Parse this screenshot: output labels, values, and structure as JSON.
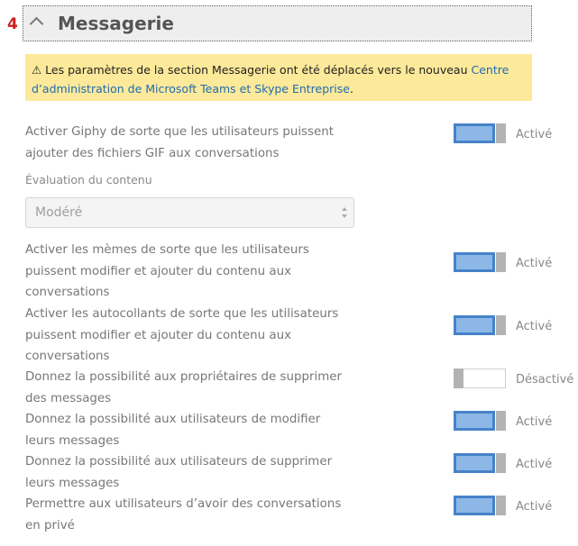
{
  "step_number": "4",
  "section": {
    "title": "Messagerie"
  },
  "notice": {
    "icon": "warning-icon",
    "text": "⚠ Les paramètres de la section Messagerie ont été déplacés vers le nouveau ",
    "link": "Centre d’administration de Microsoft Teams et Skype Entreprise",
    "suffix": "."
  },
  "colors": {
    "accent": "#4682c9",
    "toggle_fill": "#8cb7e6",
    "notice_bg": "#fce99a",
    "step": "#c8201f"
  },
  "settings": [
    {
      "line1": "Activer Giphy de sorte que les utilisateurs puissent",
      "line2": "ajouter des fichiers GIF aux conversations",
      "state": "Activé",
      "on": true
    },
    {
      "line1": "Activer les mèmes de sorte que les utilisateurs",
      "line2": "puissent modifier et ajouter du contenu aux",
      "line3": "conversations",
      "state": "Activé",
      "on": true
    },
    {
      "line1": "Activer les autocollants de sorte que les utilisateurs",
      "line2": "puissent modifier et ajouter du contenu aux",
      "line3": "conversations",
      "state": "Activé",
      "on": true
    },
    {
      "line1": "Donnez la possibilité aux propriétaires de supprimer",
      "line2": "des messages",
      "state": "Désactivé",
      "on": false
    },
    {
      "line1": "Donnez la possibilité aux utilisateurs de modifier",
      "line2": "leurs messages",
      "state": "Activé",
      "on": true
    },
    {
      "line1": "Donnez la possibilité aux utilisateurs de supprimer",
      "line2": "leurs messages",
      "state": "Activé",
      "on": true
    },
    {
      "line1": "Permettre aux utilisateurs d’avoir des conversations",
      "line2": "en privé",
      "state": "Activé",
      "on": true
    }
  ],
  "content_rating": {
    "label": "Évaluation du contenu",
    "value": "Modéré"
  }
}
